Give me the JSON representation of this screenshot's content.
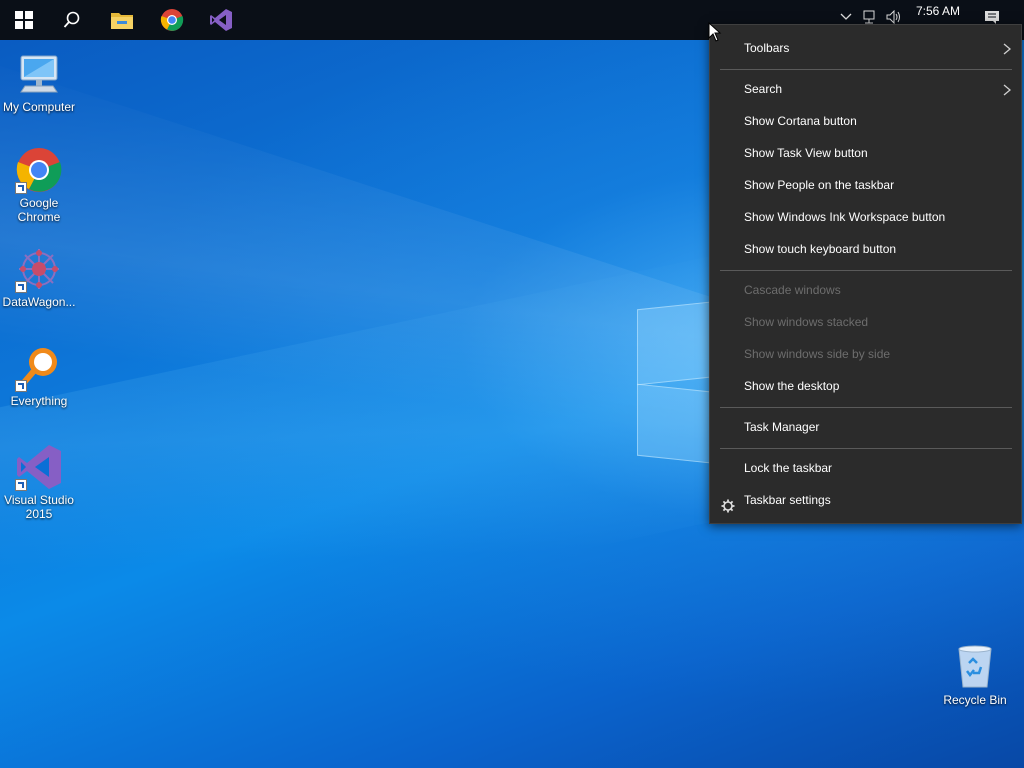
{
  "taskbar": {
    "clock": "7:56 AM",
    "pinned": [
      {
        "icon": "windows-start-icon"
      },
      {
        "icon": "search-icon"
      },
      {
        "icon": "file-explorer-icon"
      },
      {
        "icon": "chrome-icon"
      },
      {
        "icon": "visual-studio-icon"
      }
    ],
    "tray_icons": [
      "chevron-up-icon",
      "network-icon",
      "volume-icon",
      "action-center-icon"
    ]
  },
  "desktop": {
    "icons": [
      {
        "label": "My Computer",
        "icon": "computer-icon"
      },
      {
        "label": "Google Chrome",
        "icon": "chrome-icon"
      },
      {
        "label": "DataWagon...",
        "icon": "datawagon-icon"
      },
      {
        "label": "Everything",
        "icon": "everything-search-icon"
      },
      {
        "label": "Visual Studio 2015",
        "icon": "visual-studio-icon"
      },
      {
        "label": "Recycle Bin",
        "icon": "recycle-bin-icon"
      }
    ]
  },
  "context_menu": {
    "items": [
      {
        "label": "Toolbars",
        "submenu": true
      },
      {
        "label": "Search",
        "submenu": true
      },
      {
        "label": "Show Cortana button"
      },
      {
        "label": "Show Task View button"
      },
      {
        "label": "Show People on the taskbar"
      },
      {
        "label": "Show Windows Ink Workspace button"
      },
      {
        "label": "Show touch keyboard button"
      },
      {
        "label": "Cascade windows",
        "disabled": true
      },
      {
        "label": "Show windows stacked",
        "disabled": true
      },
      {
        "label": "Show windows side by side",
        "disabled": true
      },
      {
        "label": "Show the desktop"
      },
      {
        "label": "Task Manager"
      },
      {
        "label": "Lock the taskbar"
      },
      {
        "label": "Taskbar settings",
        "icon": "gear-icon"
      }
    ]
  },
  "colors": {
    "menu_bg": "#2b2b2b",
    "menu_text": "#ffffff",
    "menu_disabled": "#6d6d6d",
    "taskbar_bg": "#0a0f17",
    "desktop_blue": "#0b6fd6"
  }
}
